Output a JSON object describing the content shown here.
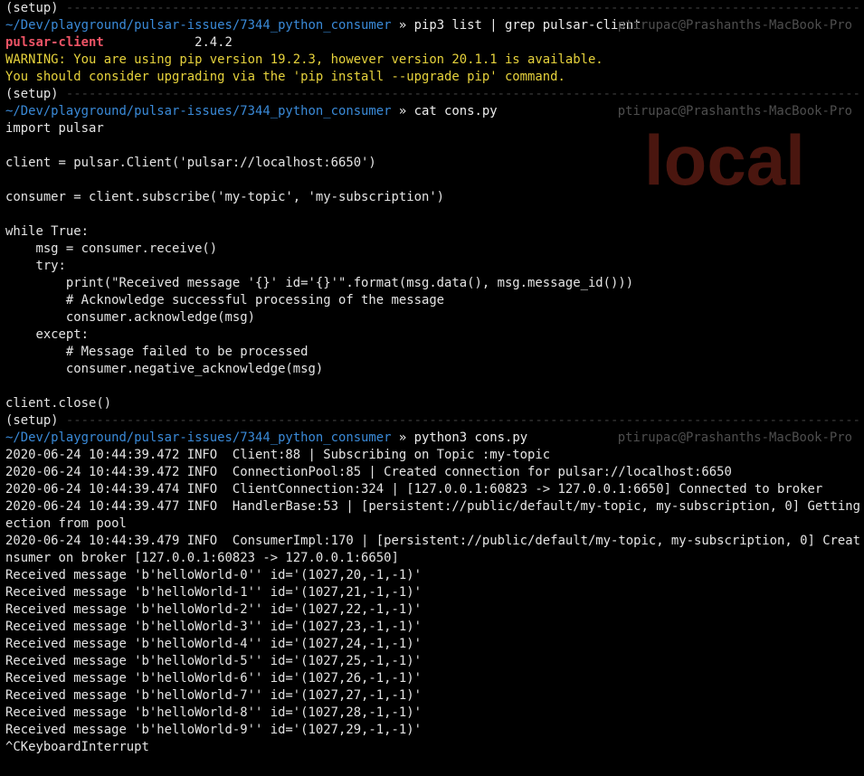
{
  "watermark": "local",
  "prompts": [
    {
      "env": "(setup)",
      "dashes": "----------------------------------------------------------------------------------------------------------------------",
      "cwd": "~/Dev/playground/pulsar-issues/7344_python_consumer",
      "sep": " » ",
      "command": "pip3 list | grep pulsar-client",
      "host": "ptirupac@Prashanths-MacBook-Pro"
    },
    {
      "env": "(setup)",
      "dashes": "----------------------------------------------------------------------------------------------------------------------",
      "cwd": "~/Dev/playground/pulsar-issues/7344_python_consumer",
      "sep": " » ",
      "command": "cat cons.py",
      "host": "ptirupac@Prashanths-MacBook-Pro"
    },
    {
      "env": "(setup)",
      "dashes": "----------------------------------------------------------------------------------------------------------------------",
      "cwd": "~/Dev/playground/pulsar-issues/7344_python_consumer",
      "sep": " » ",
      "command": "python3 cons.py",
      "host": "ptirupac@Prashanths-MacBook-Pro"
    }
  ],
  "pip_output": {
    "package": "pulsar-client",
    "padding": "            ",
    "version": "2.4.2",
    "warning1": "WARNING: You are using pip version 19.2.3, however version 20.1.1 is available.",
    "warning2": "You should consider upgrading via the 'pip install --upgrade pip' command."
  },
  "code_lines": [
    "import pulsar",
    "",
    "client = pulsar.Client('pulsar://localhost:6650')",
    "",
    "consumer = client.subscribe('my-topic', 'my-subscription')",
    "",
    "while True:",
    "    msg = consumer.receive()",
    "    try:",
    "        print(\"Received message '{}' id='{}'\".format(msg.data(), msg.message_id()))",
    "        # Acknowledge successful processing of the message",
    "        consumer.acknowledge(msg)",
    "    except:",
    "        # Message failed to be processed",
    "        consumer.negative_acknowledge(msg)",
    "",
    "client.close()"
  ],
  "log_lines": [
    "2020-06-24 10:44:39.472 INFO  Client:88 | Subscribing on Topic :my-topic",
    "2020-06-24 10:44:39.472 INFO  ConnectionPool:85 | Created connection for pulsar://localhost:6650",
    "2020-06-24 10:44:39.474 INFO  ClientConnection:324 | [127.0.0.1:60823 -> 127.0.0.1:6650] Connected to broker",
    "2020-06-24 10:44:39.477 INFO  HandlerBase:53 | [persistent://public/default/my-topic, my-subscription, 0] Getting conn",
    "ection from pool",
    "2020-06-24 10:44:39.479 INFO  ConsumerImpl:170 | [persistent://public/default/my-topic, my-subscription, 0] Created co",
    "nsumer on broker [127.0.0.1:60823 -> 127.0.0.1:6650]",
    "Received message 'b'helloWorld-0'' id='(1027,20,-1,-1)'",
    "Received message 'b'helloWorld-1'' id='(1027,21,-1,-1)'",
    "Received message 'b'helloWorld-2'' id='(1027,22,-1,-1)'",
    "Received message 'b'helloWorld-3'' id='(1027,23,-1,-1)'",
    "Received message 'b'helloWorld-4'' id='(1027,24,-1,-1)'",
    "Received message 'b'helloWorld-5'' id='(1027,25,-1,-1)'",
    "Received message 'b'helloWorld-6'' id='(1027,26,-1,-1)'",
    "Received message 'b'helloWorld-7'' id='(1027,27,-1,-1)'",
    "Received message 'b'helloWorld-8'' id='(1027,28,-1,-1)'",
    "Received message 'b'helloWorld-9'' id='(1027,29,-1,-1)'",
    "^CKeyboardInterrupt"
  ],
  "colors": {
    "background": "#000000",
    "text": "#e4e4e4",
    "path": "#3a8ad8",
    "package": "#ee5466",
    "warning": "#e6d23c",
    "host": "#4e4e4e",
    "watermark": "#4a160f"
  }
}
